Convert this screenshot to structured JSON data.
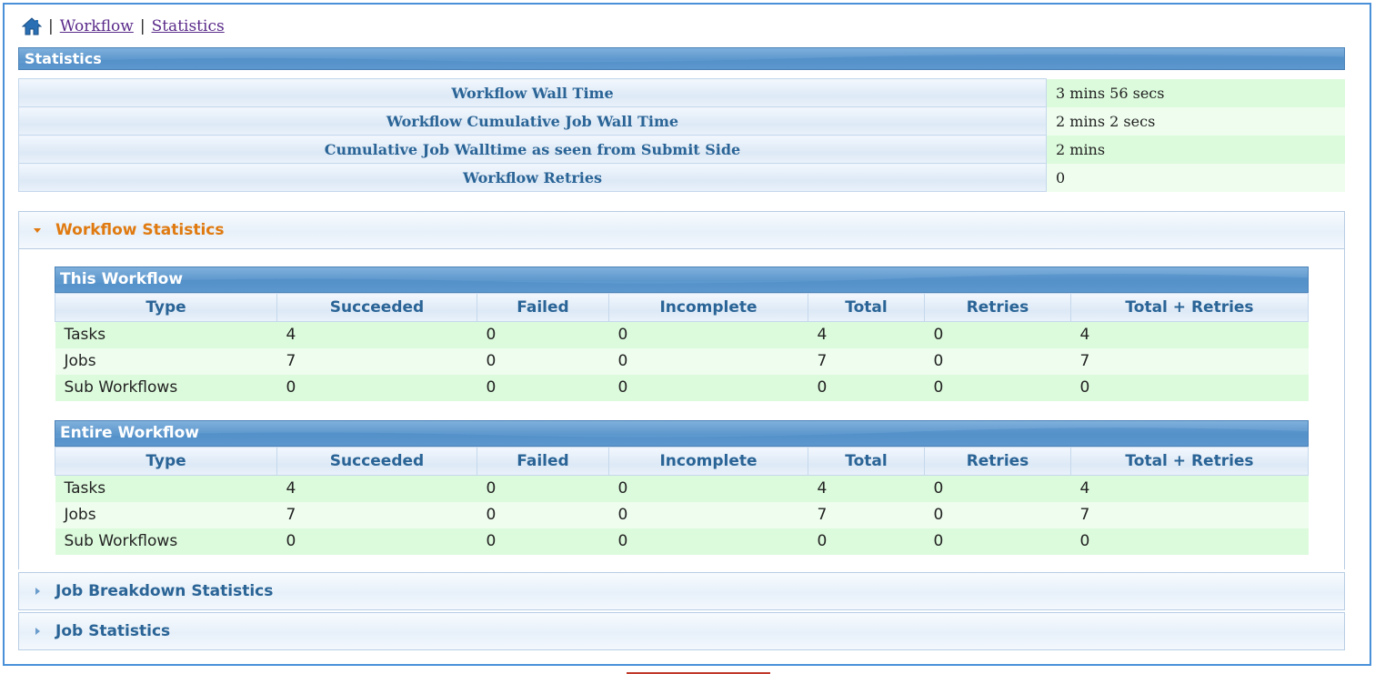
{
  "breadcrumb": {
    "home_icon": "home-icon",
    "links": [
      "Workflow",
      "Statistics"
    ],
    "separator": "|"
  },
  "statistics": {
    "header": "Statistics",
    "rows": [
      {
        "label": "Workflow Wall Time",
        "value": "3 mins 56 secs"
      },
      {
        "label": "Workflow Cumulative Job Wall Time",
        "value": "2 mins 2 secs"
      },
      {
        "label": "Cumulative Job Walltime as seen from Submit Side",
        "value": "2 mins"
      },
      {
        "label": "Workflow Retries",
        "value": "0"
      }
    ]
  },
  "workflow_statistics": {
    "title": "Workflow Statistics",
    "columns": [
      "Type",
      "Succeeded",
      "Failed",
      "Incomplete",
      "Total",
      "Retries",
      "Total + Retries"
    ],
    "this_workflow": {
      "title": "This Workflow",
      "rows": [
        [
          "Tasks",
          "4",
          "0",
          "0",
          "4",
          "0",
          "4"
        ],
        [
          "Jobs",
          "7",
          "0",
          "0",
          "7",
          "0",
          "7"
        ],
        [
          "Sub Workflows",
          "0",
          "0",
          "0",
          "0",
          "0",
          "0"
        ]
      ]
    },
    "entire_workflow": {
      "title": "Entire Workflow",
      "rows": [
        [
          "Tasks",
          "4",
          "0",
          "0",
          "4",
          "0",
          "4"
        ],
        [
          "Jobs",
          "7",
          "0",
          "0",
          "7",
          "0",
          "7"
        ],
        [
          "Sub Workflows",
          "0",
          "0",
          "0",
          "0",
          "0",
          "0"
        ]
      ]
    }
  },
  "collapsed_sections": [
    {
      "title": "Job Breakdown Statistics"
    },
    {
      "title": "Job Statistics"
    }
  ],
  "colors": {
    "header_blue": "#5c97cd",
    "label_blue": "#2a6496",
    "active_orange": "#e07a10",
    "row_green": "#dcfadc",
    "row_green_light": "#eefdee"
  }
}
